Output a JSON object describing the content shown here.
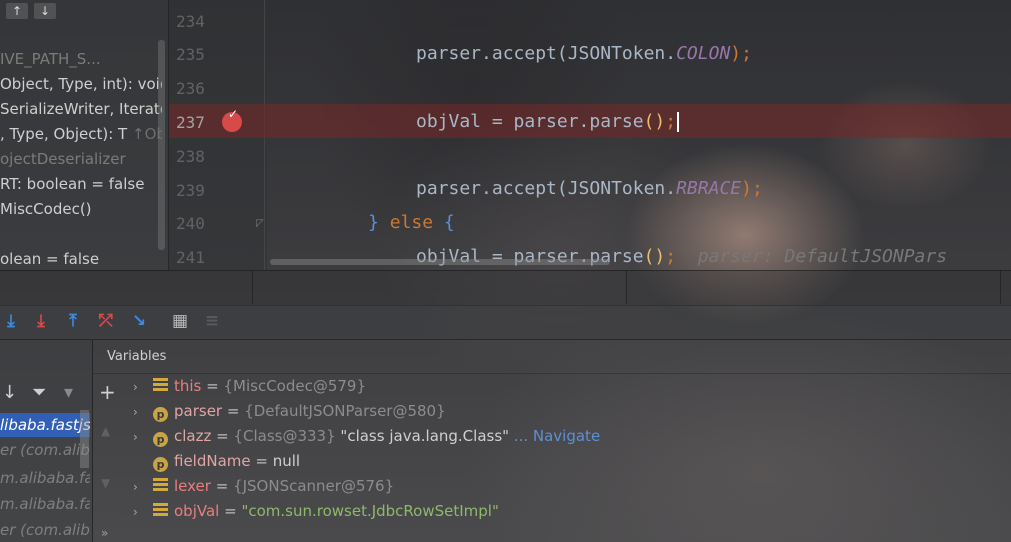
{
  "structure": {
    "toolbar": [
      "↑",
      "↓"
    ],
    "rows": [
      {
        "text": "IVE_PATH_S...",
        "dim": true
      },
      {
        "text": "Object, Type, int): void",
        "dim": false
      },
      {
        "text": "SerializeWriter, Iterator",
        "dim": false
      },
      {
        "text": ", Type, Object): T",
        "dim": false
      },
      {
        "text": "↑Obje",
        "dim": true
      },
      {
        "text": "ojectDeserializer",
        "dim": true
      },
      {
        "text": "RT: boolean = false",
        "dim": false
      },
      {
        "text": "MiscCodec()",
        "dim": false
      },
      {
        "text": "olean = false",
        "dim": false
      }
    ]
  },
  "editor": {
    "line_numbers": [
      "234",
      "235",
      "236",
      "237",
      "238",
      "239",
      "240",
      "241"
    ],
    "active_line": "237",
    "code": {
      "l235_obj": "parser.accept(",
      "l235_cls": "JSONToken.",
      "l235_const": "COLON",
      "l235_end": ");",
      "l237_a": "objVal = parser.parse",
      "l237_p": "()",
      "l237_semi": ";",
      "l239_obj": "parser.accept(",
      "l239_cls": "JSONToken.",
      "l239_const": "RBRACE",
      "l239_end": ");",
      "l240_brace1": "}",
      "l240_kw": "else",
      "l240_brace2": "{",
      "l241_a": "objVal = parser.parse",
      "l241_p": "()",
      "l241_semi": ";",
      "l241_hint": "parser: DefaultJSONPars"
    }
  },
  "debug_toolbar": {
    "buttons": [
      {
        "glyph": "⤓",
        "color": "#3d8ae0"
      },
      {
        "glyph": "⤓",
        "color": "#d64a4a"
      },
      {
        "glyph": "⤒",
        "color": "#3d8ae0"
      },
      {
        "glyph": "⤱",
        "color": "#d64a4a"
      },
      {
        "glyph": "↘",
        "color": "#3d8ae0"
      },
      {
        "glyph": "▦",
        "color": "#bbbbbb"
      },
      {
        "glyph": "≡",
        "color": "#5a5a5a"
      }
    ]
  },
  "frames": {
    "toolbar": [
      "↓",
      "⏷",
      "▾"
    ],
    "rows": [
      {
        "text": "libaba.fastjso",
        "selected": true
      },
      {
        "text": "er (com.aliba",
        "selected": false
      },
      {
        "text": "m.alibaba.fas",
        "selected": false
      },
      {
        "text": "m.alibaba.fas",
        "selected": false
      },
      {
        "text": "er (com.aliba",
        "selected": false
      }
    ]
  },
  "variables": {
    "header": "Variables",
    "side_more": "»",
    "items": [
      {
        "expand": "›",
        "icon": "field",
        "name": "this",
        "eq": " = ",
        "value": "{MiscCodec@579}",
        "extra": "",
        "link": ""
      },
      {
        "expand": "›",
        "icon": "param",
        "name": "parser",
        "eq": " = ",
        "value": "{DefaultJSONParser@580}",
        "extra": "",
        "link": ""
      },
      {
        "expand": "›",
        "icon": "param",
        "name": "clazz",
        "eq": " = ",
        "value": "{Class@333}",
        "extra": " \"class java.lang.Class\"",
        "link": " ... Navigate"
      },
      {
        "expand": "",
        "icon": "param",
        "name": "fieldName",
        "eq": " = ",
        "value": "null",
        "extra": "",
        "link": ""
      },
      {
        "expand": "›",
        "icon": "field",
        "name": "lexer",
        "eq": " = ",
        "value": "{JSONScanner@576}",
        "extra": "",
        "link": ""
      },
      {
        "expand": "›",
        "icon": "field",
        "name": "objVal",
        "eq": " = ",
        "value": "\"com.sun.rowset.JdbcRowSetImpl\"",
        "extra": "",
        "link": ""
      }
    ]
  }
}
